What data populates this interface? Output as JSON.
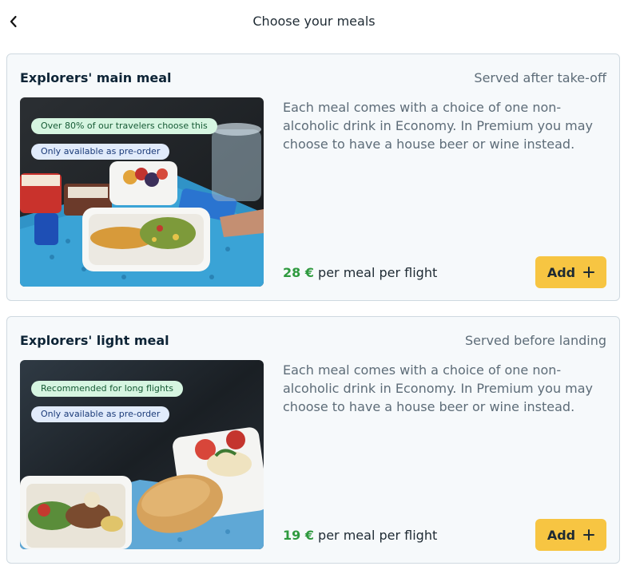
{
  "header": {
    "title": "Choose your meals",
    "back_icon": "chevron-left-icon"
  },
  "meals": [
    {
      "title": "Explorers' main meal",
      "served": "Served after take-off",
      "badges": [
        "Over 80% of our travelers choose this",
        "Only available as pre-order"
      ],
      "description": "Each meal comes with a choice of one non-alcoholic drink in Economy. In Premium you may choose to have a house beer or wine instead.",
      "price": "28 €",
      "price_suffix": " per meal per flight",
      "add_label": "Add",
      "add_icon": "plus-icon"
    },
    {
      "title": "Explorers' light meal",
      "served": "Served before landing",
      "badges": [
        "Recommended for long flights",
        "Only available as pre-order"
      ],
      "description": "Each meal comes with a choice of one non-alcoholic drink in Economy. In Premium you may choose to have a house beer or wine instead.",
      "price": "19 €",
      "price_suffix": " per meal per flight",
      "add_label": "Add",
      "add_icon": "plus-icon"
    }
  ],
  "colors": {
    "price": "#2f9a3f",
    "add_button": "#f7c542",
    "badge_green": "#d6f5e1",
    "badge_blue": "#e1ebfb"
  }
}
